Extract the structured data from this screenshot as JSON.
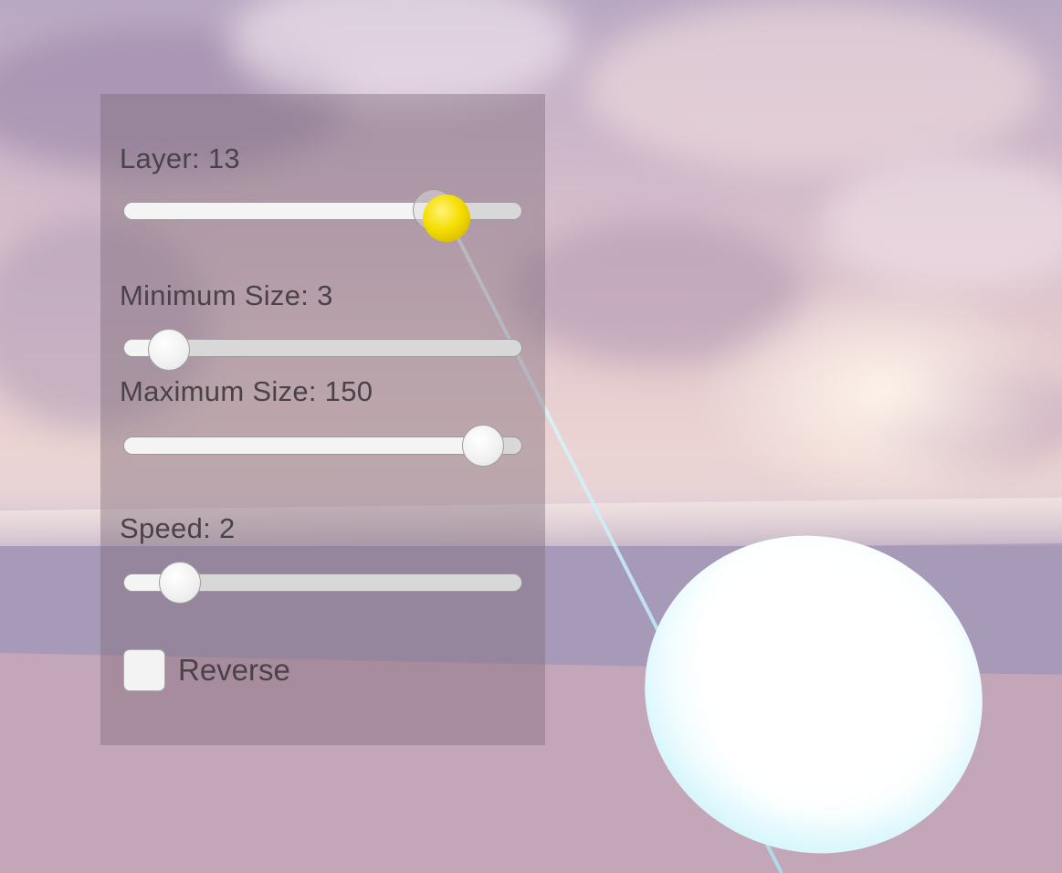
{
  "panel": {
    "layer": {
      "label": "Layer: 13",
      "value": 13,
      "fraction": 0.81
    },
    "min_size": {
      "label": "Minimum Size: 3",
      "value": 3,
      "fraction": 0.07
    },
    "max_size": {
      "label": "Maximum Size: 150",
      "value": 150,
      "fraction": 0.95
    },
    "speed": {
      "label": "Speed: 2",
      "value": 2,
      "fraction": 0.1
    },
    "reverse": {
      "label": "Reverse",
      "checked": false
    }
  },
  "colors": {
    "panel_bg": "#7d6978",
    "track": "#d8d8d8",
    "track_fill": "#f4f4f4",
    "pointer": "#f5de00",
    "laser": "#aae1f0"
  }
}
